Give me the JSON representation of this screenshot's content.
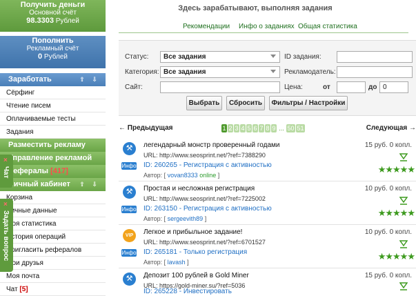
{
  "sidebar": {
    "balance_main": {
      "title": "Получить деньги",
      "subtitle": "Основной счёт",
      "amount": "98.3303",
      "currency": "Рублей"
    },
    "balance_ad": {
      "title": "Пополнить",
      "subtitle": "Рекламный счёт",
      "amount": "0",
      "currency": "Рублей"
    },
    "earn_header": "Заработать",
    "arrows": "⇧ ⇩",
    "earn_items": [
      "Сёрфинг",
      "Чтение писем",
      "Оплачиваемые тесты",
      "Задания"
    ],
    "place_ad": "Разместить рекламу",
    "manage_ad": "Управление рекламой",
    "referrals": "Рефералы",
    "referrals_count": "[417]",
    "cabinet": "Личный кабинет",
    "cabinet_items": [
      "Корзина",
      "Личные данные",
      "Моя статистика",
      "История операций",
      "Пригласить рефералов",
      "Мои друзья",
      "Моя почта"
    ],
    "chat_item": "Чат",
    "chat_count": "[5]",
    "tab_chat": "Чат",
    "tab_question": "Задать вопрос",
    "tab_close": "×"
  },
  "main": {
    "headline": "Здесь зарабатывают, выполняя задания",
    "tabs": [
      "Рекомендации",
      "Инфо о заданиях",
      "Общая статистика"
    ],
    "filter": {
      "status_label": "Статус:",
      "status_value": "Все задания",
      "category_label": "Категория:",
      "category_value": "Все задания",
      "site_label": "Сайт:",
      "site_value": "",
      "task_id_label": "ID задания:",
      "advertiser_label": "Рекламодатель:",
      "price_label": "Цена:",
      "from_label": "от",
      "to_label": "до",
      "to_value": "0",
      "btn_select": "Выбрать",
      "btn_reset": "Сбросить",
      "btn_filters": "Фильтры / Настройки"
    },
    "pager": {
      "prev": "← Предыдущая",
      "next": "Следующая →",
      "pages": [
        "1",
        "2",
        "3",
        "4",
        "5",
        "6",
        "7",
        "8",
        "9"
      ],
      "dots": "...",
      "tail": [
        "50",
        "51"
      ]
    },
    "tasks": [
      {
        "title": "легендарный монстр проверенный годами",
        "url": "URL: http://www.seosprint.net/?ref=7388290",
        "id": "ID: 260265 - Регистрация с активностью",
        "author_prefix": "Автор: [",
        "author": "vovan8333",
        "online": "online",
        "author_suffix": "]",
        "price": "15 руб. 0 копл.",
        "icon": "worker-icon",
        "icon_glyph": "⚒"
      },
      {
        "title": "Простая и несложная регистрация",
        "url": "URL: http://www.seosprint.net/?ref=7225002",
        "id": "ID: 263150 - Регистрация с активностью",
        "author_prefix": "Автор: [",
        "author": "sergeevith89",
        "online": "",
        "author_suffix": "]",
        "price": "10 руб. 0 копл.",
        "icon": "worker-icon",
        "icon_glyph": "⚒"
      },
      {
        "title": "Легкое и прибыльное задание!",
        "url": "URL: http://www.seosprint.net/?ref=6701527",
        "id": "ID: 265181 - Только регистрация",
        "author_prefix": "Автор: [",
        "author": "lavash",
        "online": "",
        "author_suffix": "]",
        "price": "10 руб. 0 копл.",
        "icon": "vip-icon",
        "icon_glyph": "VIP"
      },
      {
        "title": "Депозит 100 рублей в Gold Miner",
        "url": "URL: https://gold-miner.su/?ref=5036",
        "id": "ID: 265228 - Инвестировать",
        "author_prefix": "Автор: [",
        "author": "",
        "online": "",
        "author_suffix": "]",
        "price": "15 руб. 0 копл.",
        "icon": "worker-icon",
        "icon_glyph": "⚒"
      }
    ],
    "info_label": "Инфо",
    "stars": "★★★★★"
  },
  "colors": {
    "accent_green": "#5e9a3c",
    "accent_blue": "#3f73ab",
    "link": "#1f6fc4"
  }
}
